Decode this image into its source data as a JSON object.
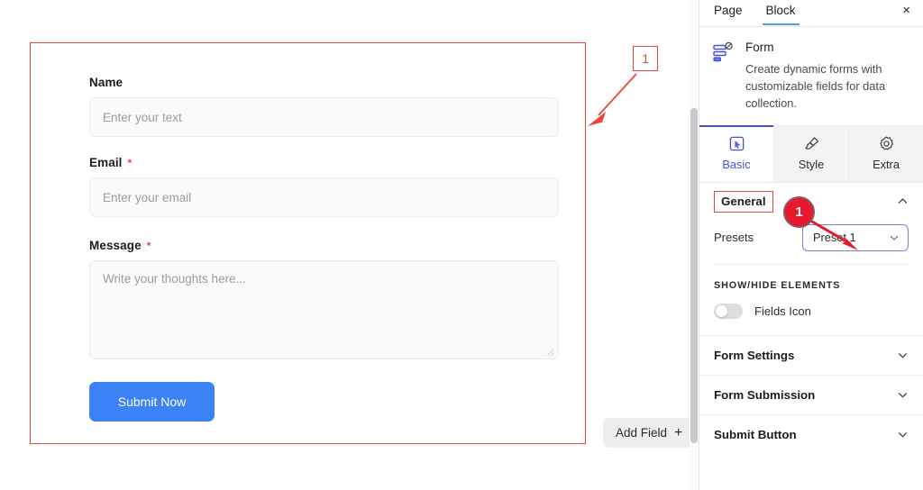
{
  "canvas": {
    "form": {
      "fields": [
        {
          "label": "Name",
          "required": false,
          "placeholder": "Enter your text",
          "type": "text"
        },
        {
          "label": "Email",
          "required": true,
          "placeholder": "Enter your email",
          "type": "text"
        },
        {
          "label": "Message",
          "required": true,
          "placeholder": "Write your thoughts here...",
          "type": "textarea"
        }
      ],
      "required_mark": "*",
      "submit_label": "Submit Now"
    },
    "add_field_label": "Add Field",
    "add_field_plus": "+",
    "callout_number": "1"
  },
  "panel": {
    "tabs": [
      {
        "label": "Page",
        "active": false
      },
      {
        "label": "Block",
        "active": true
      }
    ],
    "close_label": "×",
    "block": {
      "icon": "form-icon",
      "title": "Form",
      "description": "Create dynamic forms with customizable fields for data collection."
    },
    "setting_tabs": [
      {
        "label": "Basic",
        "icon": "cursor-square-icon",
        "active": true
      },
      {
        "label": "Style",
        "icon": "paintbrush-icon",
        "active": false
      },
      {
        "label": "Extra",
        "icon": "gear-icon",
        "active": false
      }
    ],
    "general": {
      "title": "General",
      "collapse_icon": "chevron-up-icon",
      "presets_label": "Presets",
      "presets_value": "Preset 1",
      "presets_chevron": "chevron-down-icon"
    },
    "show_hide": {
      "title": "SHOW/HIDE ELEMENTS",
      "toggles": [
        {
          "label": "Fields Icon",
          "on": false
        }
      ]
    },
    "sections": [
      {
        "title": "Form Settings",
        "chevron": "chevron-down-icon"
      },
      {
        "title": "Form Submission",
        "chevron": "chevron-down-icon"
      },
      {
        "title": "Submit Button",
        "chevron": "chevron-down-icon"
      }
    ],
    "callout_number": "1"
  },
  "colors": {
    "accent_blue": "#3b82f6",
    "annotation_red": "#e8453c",
    "badge_red": "#e8192c",
    "active_indigo": "#4b4fd6",
    "tab_underline": "#5b9dd9"
  }
}
